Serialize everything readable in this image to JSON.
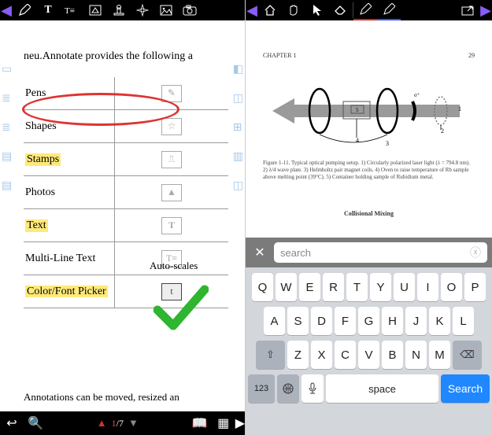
{
  "left": {
    "intro": "neu.Annotate provides the following a",
    "rows": [
      {
        "label": "Pens",
        "hl": false,
        "icon": "pencil"
      },
      {
        "label": "Shapes",
        "hl": false,
        "icon": "star-box"
      },
      {
        "label": "Stamps",
        "hl": true,
        "icon": "stamp"
      },
      {
        "label": "Photos",
        "hl": false,
        "icon": "image"
      },
      {
        "label": "Text",
        "hl": true,
        "icon": "text-t"
      },
      {
        "label": "Multi-Line Text",
        "hl": false,
        "icon": "multiline-t"
      },
      {
        "label": "Color/Font Picker",
        "hl": true,
        "icon": "t-box"
      }
    ],
    "autoscale": "Auto-scales",
    "footer": "Annotations can be moved, resized an",
    "page_current": "1",
    "page_total": "7"
  },
  "right": {
    "chapter": "CHAPTER 1",
    "pagenum": "29",
    "caption": "Figure 1-11. Typical optical pumping setup. 1) Circularly polarized laser light (λ = 794.8 nm). 2) λ/4 wave plate. 3) Helmholtz pair magnet coils. 4) Oven to raise temperature of Rb sample above melting point (39°C). 5) Container holding sample of Rubidium metal.",
    "collisional": "Collisional Mixing",
    "search_placeholder": "search",
    "keyboard": {
      "row1": [
        "Q",
        "W",
        "E",
        "R",
        "T",
        "Y",
        "U",
        "I",
        "O",
        "P"
      ],
      "row2": [
        "A",
        "S",
        "D",
        "F",
        "G",
        "H",
        "J",
        "K",
        "L"
      ],
      "row3": [
        "Z",
        "X",
        "C",
        "V",
        "B",
        "N",
        "M"
      ],
      "shift": "⇧",
      "backspace": "⌫",
      "numbers": "123",
      "globe": "🌐",
      "mic": "🎤",
      "space": "space",
      "search": "Search"
    }
  }
}
